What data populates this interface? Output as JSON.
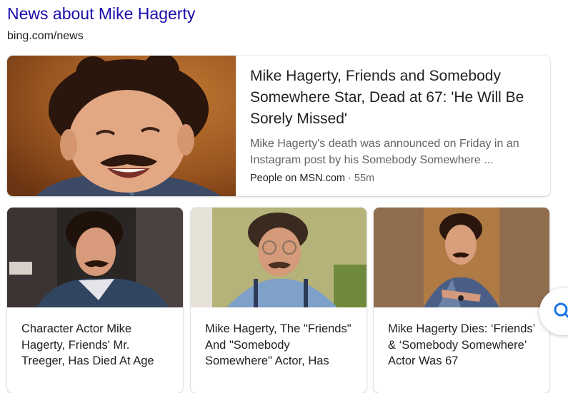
{
  "section": {
    "title": "News about Mike Hagerty",
    "source": "bing.com/news"
  },
  "top_story": {
    "headline": "Mike Hagerty, Friends and Somebody Somewhere Star, Dead at 67: 'He Will Be Sorely Missed'",
    "snippet": "Mike Hagerty's death was announced on Friday in an Instagram post by his Somebody Somewhere ...",
    "publisher": "People on MSN.com",
    "separator": " · ",
    "age": "55m"
  },
  "stories": [
    {
      "headline": "Character Actor Mike Hagerty, Friends' Mr. Treeger, Has Died At Age"
    },
    {
      "headline": "Mike Hagerty, The \"Friends\" And \"Somebody Somewhere\" Actor, Has"
    },
    {
      "headline": "Mike Hagerty Dies: ‘Friends’ & ‘Somebody Somewhere’ Actor Was 67"
    }
  ],
  "colors": {
    "link": "#1a0dab",
    "text": "#202124",
    "secondary": "#5f6368",
    "search_icon": "#1a73e8"
  },
  "icons": {
    "search": "search-icon"
  }
}
